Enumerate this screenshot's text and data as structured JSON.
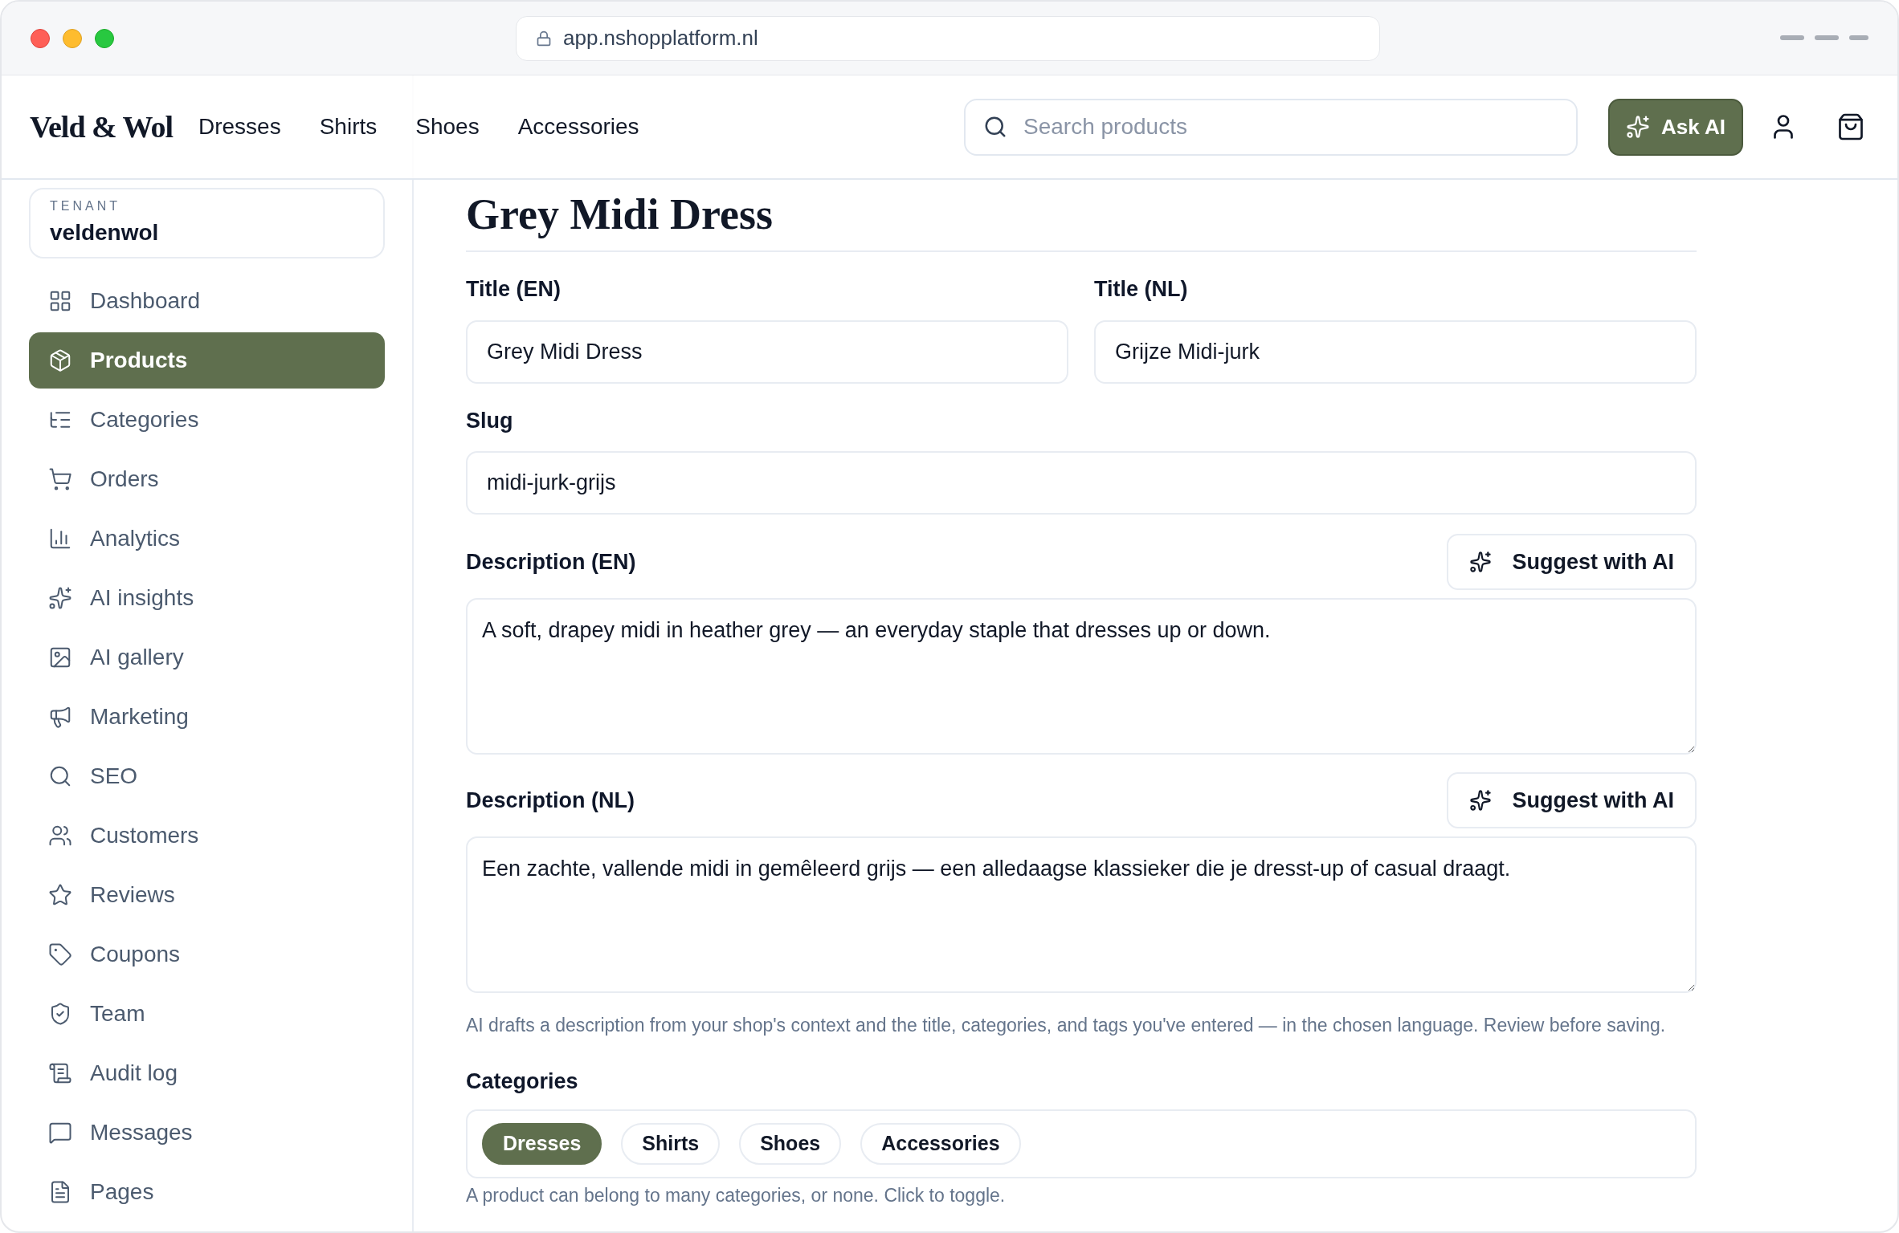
{
  "browser": {
    "url": "app.nshopplatform.nl"
  },
  "header": {
    "logo": "Veld & Wol",
    "nav": [
      "Dresses",
      "Shirts",
      "Shoes",
      "Accessories"
    ],
    "search": {
      "placeholder": "Search products"
    },
    "ask_button": "Ask AI"
  },
  "sidebar": {
    "tenant_label": "TENANT",
    "tenant": "veldenwol",
    "items": [
      {
        "label": "Dashboard",
        "selected": false
      },
      {
        "label": "Products",
        "selected": true
      },
      {
        "label": "Categories",
        "selected": false
      },
      {
        "label": "Orders",
        "selected": false
      },
      {
        "label": "Analytics",
        "selected": false
      },
      {
        "label": "AI insights",
        "selected": false
      },
      {
        "label": "AI gallery",
        "selected": false
      },
      {
        "label": "Marketing",
        "selected": false
      },
      {
        "label": "SEO",
        "selected": false
      },
      {
        "label": "Customers",
        "selected": false
      },
      {
        "label": "Reviews",
        "selected": false
      },
      {
        "label": "Coupons",
        "selected": false
      },
      {
        "label": "Team",
        "selected": false
      },
      {
        "label": "Audit log",
        "selected": false
      },
      {
        "label": "Messages",
        "selected": false
      },
      {
        "label": "Pages",
        "selected": false
      }
    ]
  },
  "form": {
    "heading": "Grey Midi Dress",
    "title_en": {
      "label": "Title (EN)",
      "value": "Grey Midi Dress"
    },
    "title_nl": {
      "label": "Title (NL)",
      "value": "Grijze Midi-jurk"
    },
    "slug": {
      "label": "Slug",
      "value": "midi-jurk-grijs"
    },
    "descriptions": [
      {
        "label": "Description (EN)",
        "button": "Suggest with AI",
        "value": "A soft, drapey midi in heather grey — an everyday staple that dresses up or down."
      },
      {
        "label": "Description (NL)",
        "button": "Suggest with AI",
        "value": "Een zachte, vallende midi in gemêleerd grijs — een alledaagse klassieker die je dresst-up of casual draagt."
      }
    ],
    "description_help": "AI drafts a description from your shop's context and the title, categories, and tags you've entered — in the chosen language. Review before saving.",
    "categories_label": "Categories",
    "categories": [
      {
        "label": "Dresses",
        "selected": true
      },
      {
        "label": "Shirts",
        "selected": false
      },
      {
        "label": "Shoes",
        "selected": false
      },
      {
        "label": "Accessories",
        "selected": false
      }
    ],
    "categories_help": "A product can belong to many categories, or none. Click to toggle."
  }
}
